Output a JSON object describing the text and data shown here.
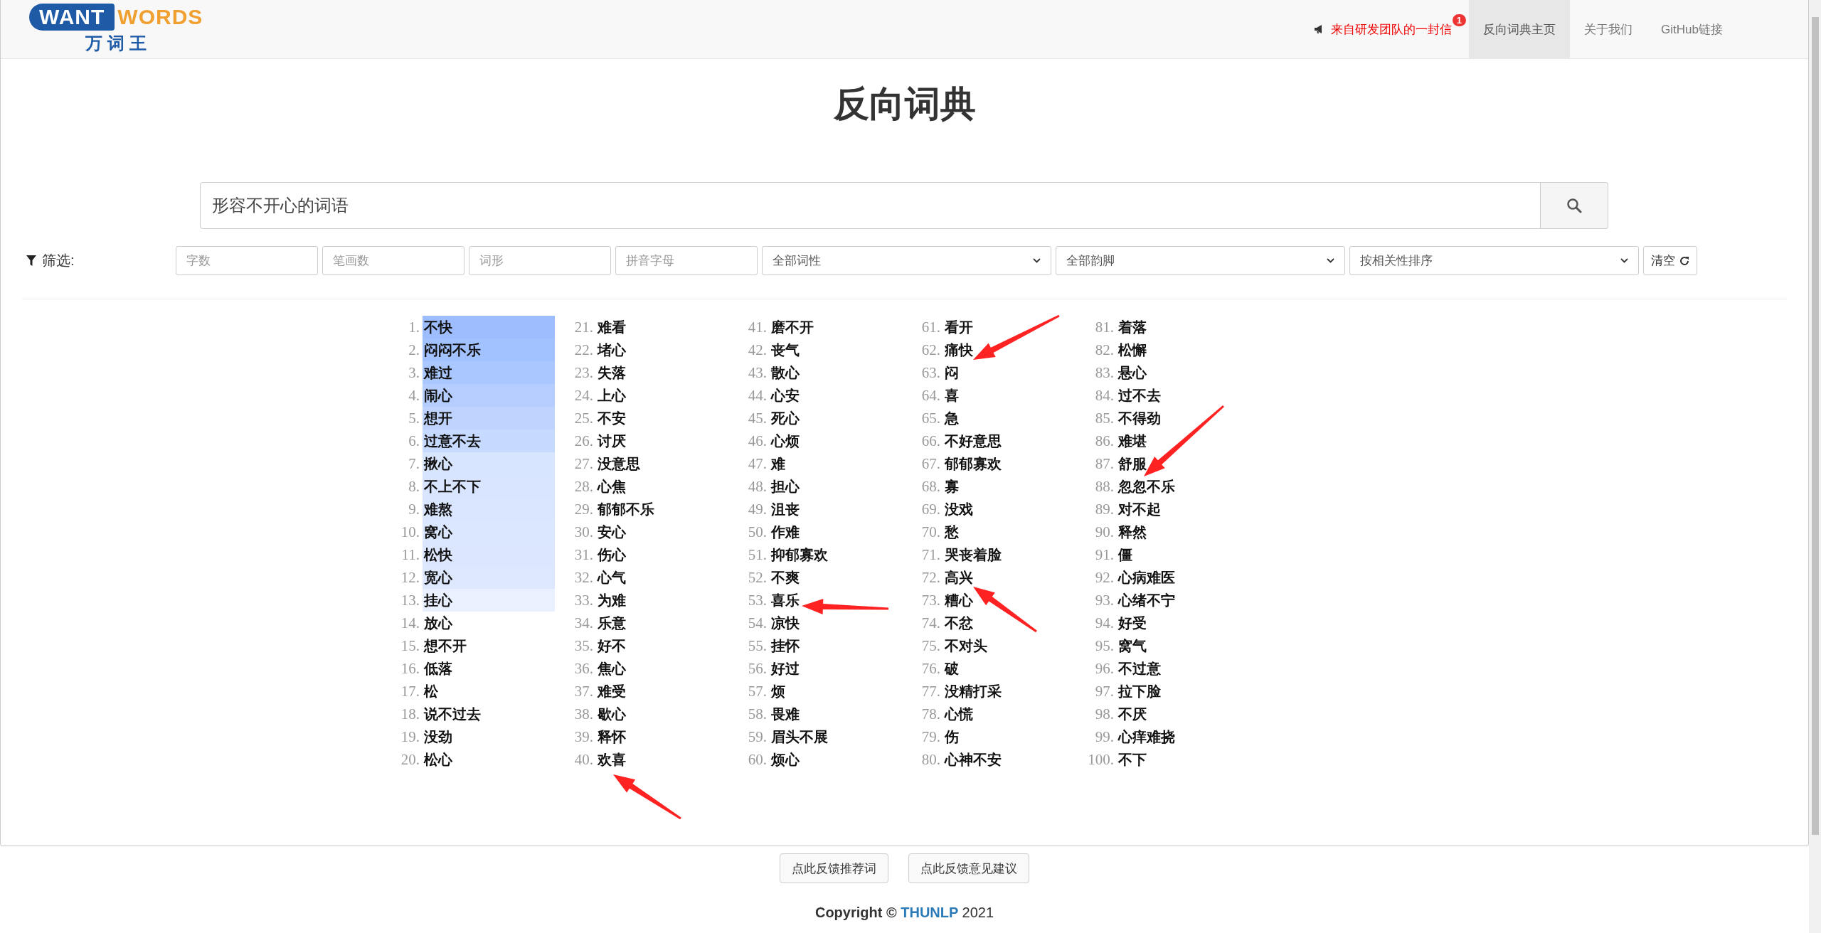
{
  "header": {
    "logo": {
      "word_left": "WANT",
      "word_right": "WORDS",
      "subtitle": "万 词 王"
    },
    "notice": {
      "text": "来自研发团队的一封信",
      "badge": "1"
    },
    "nav": [
      {
        "label": "反向词典主页",
        "selected": true
      },
      {
        "label": "关于我们",
        "selected": false
      },
      {
        "label": "GitHub链接",
        "selected": false
      }
    ]
  },
  "title": "反向词典",
  "search": {
    "value": "形容不开心的词语"
  },
  "filter": {
    "label": "筛选:",
    "fields": [
      {
        "kind": "input",
        "placeholder": "字数"
      },
      {
        "kind": "input",
        "placeholder": "笔画数"
      },
      {
        "kind": "input",
        "placeholder": "词形"
      },
      {
        "kind": "input",
        "placeholder": "拼音字母"
      },
      {
        "kind": "select",
        "value": "全部词性"
      },
      {
        "kind": "select",
        "value": "全部韵脚"
      },
      {
        "kind": "select",
        "value": "按相关性排序"
      }
    ],
    "clear_button": "清空"
  },
  "results": [
    {
      "index": "1.",
      "word": "不快",
      "color": "#9dbdff"
    },
    {
      "index": "2.",
      "word": "闷闷不乐",
      "color": "#a2c1ff"
    },
    {
      "index": "3.",
      "word": "难过",
      "color": "#aac7ff"
    },
    {
      "index": "4.",
      "word": "闹心",
      "color": "#b5ceff"
    },
    {
      "index": "5.",
      "word": "想开",
      "color": "#bed4ff"
    },
    {
      "index": "6.",
      "word": "过意不去",
      "color": "#c6daff"
    },
    {
      "index": "7.",
      "word": "揪心",
      "color": "#d8e5ff"
    },
    {
      "index": "8.",
      "word": "不上不下",
      "color": "#d9e5ff"
    },
    {
      "index": "9.",
      "word": "难熬",
      "color": "#dae6ff"
    },
    {
      "index": "10.",
      "word": "窝心",
      "color": "#dbe7ff"
    },
    {
      "index": "11.",
      "word": "松快",
      "color": "#dce7ff"
    },
    {
      "index": "12.",
      "word": "宽心",
      "color": "#dde8ff"
    },
    {
      "index": "13.",
      "word": "挂心",
      "color": "#e9f0ff"
    },
    {
      "index": "14.",
      "word": "放心"
    },
    {
      "index": "15.",
      "word": "想不开"
    },
    {
      "index": "16.",
      "word": "低落"
    },
    {
      "index": "17.",
      "word": "松"
    },
    {
      "index": "18.",
      "word": "说不过去"
    },
    {
      "index": "19.",
      "word": "没劲"
    },
    {
      "index": "20.",
      "word": "松心"
    },
    {
      "index": "21.",
      "word": "难看"
    },
    {
      "index": "22.",
      "word": "堵心"
    },
    {
      "index": "23.",
      "word": "失落"
    },
    {
      "index": "24.",
      "word": "上心"
    },
    {
      "index": "25.",
      "word": "不安"
    },
    {
      "index": "26.",
      "word": "讨厌"
    },
    {
      "index": "27.",
      "word": "没意思"
    },
    {
      "index": "28.",
      "word": "心焦"
    },
    {
      "index": "29.",
      "word": "郁郁不乐"
    },
    {
      "index": "30.",
      "word": "安心"
    },
    {
      "index": "31.",
      "word": "伤心"
    },
    {
      "index": "32.",
      "word": "心气"
    },
    {
      "index": "33.",
      "word": "为难"
    },
    {
      "index": "34.",
      "word": "乐意"
    },
    {
      "index": "35.",
      "word": "好不"
    },
    {
      "index": "36.",
      "word": "焦心"
    },
    {
      "index": "37.",
      "word": "难受"
    },
    {
      "index": "38.",
      "word": "歇心"
    },
    {
      "index": "39.",
      "word": "释怀"
    },
    {
      "index": "40.",
      "word": "欢喜"
    },
    {
      "index": "41.",
      "word": "磨不开"
    },
    {
      "index": "42.",
      "word": "丧气"
    },
    {
      "index": "43.",
      "word": "散心"
    },
    {
      "index": "44.",
      "word": "心安"
    },
    {
      "index": "45.",
      "word": "死心"
    },
    {
      "index": "46.",
      "word": "心烦"
    },
    {
      "index": "47.",
      "word": "难"
    },
    {
      "index": "48.",
      "word": "担心"
    },
    {
      "index": "49.",
      "word": "沮丧"
    },
    {
      "index": "50.",
      "word": "作难"
    },
    {
      "index": "51.",
      "word": "抑郁寡欢"
    },
    {
      "index": "52.",
      "word": "不爽"
    },
    {
      "index": "53.",
      "word": "喜乐"
    },
    {
      "index": "54.",
      "word": "凉快"
    },
    {
      "index": "55.",
      "word": "挂怀"
    },
    {
      "index": "56.",
      "word": "好过"
    },
    {
      "index": "57.",
      "word": "烦"
    },
    {
      "index": "58.",
      "word": "畏难"
    },
    {
      "index": "59.",
      "word": "眉头不展"
    },
    {
      "index": "60.",
      "word": "烦心"
    },
    {
      "index": "61.",
      "word": "看开"
    },
    {
      "index": "62.",
      "word": "痛快"
    },
    {
      "index": "63.",
      "word": "闷"
    },
    {
      "index": "64.",
      "word": "喜"
    },
    {
      "index": "65.",
      "word": "急"
    },
    {
      "index": "66.",
      "word": "不好意思"
    },
    {
      "index": "67.",
      "word": "郁郁寡欢"
    },
    {
      "index": "68.",
      "word": "寡"
    },
    {
      "index": "69.",
      "word": "没戏"
    },
    {
      "index": "70.",
      "word": "愁"
    },
    {
      "index": "71.",
      "word": "哭丧着脸"
    },
    {
      "index": "72.",
      "word": "高兴"
    },
    {
      "index": "73.",
      "word": "糟心"
    },
    {
      "index": "74.",
      "word": "不忿"
    },
    {
      "index": "75.",
      "word": "不对头"
    },
    {
      "index": "76.",
      "word": "破"
    },
    {
      "index": "77.",
      "word": "没精打采"
    },
    {
      "index": "78.",
      "word": "心慌"
    },
    {
      "index": "79.",
      "word": "伤"
    },
    {
      "index": "80.",
      "word": "心神不安"
    },
    {
      "index": "81.",
      "word": "着落"
    },
    {
      "index": "82.",
      "word": "松懈"
    },
    {
      "index": "83.",
      "word": "悬心"
    },
    {
      "index": "84.",
      "word": "过不去"
    },
    {
      "index": "85.",
      "word": "不得劲"
    },
    {
      "index": "86.",
      "word": "难堪"
    },
    {
      "index": "87.",
      "word": "舒服"
    },
    {
      "index": "88.",
      "word": "忽忽不乐"
    },
    {
      "index": "89.",
      "word": "对不起"
    },
    {
      "index": "90.",
      "word": "释然"
    },
    {
      "index": "91.",
      "word": "僵"
    },
    {
      "index": "92.",
      "word": "心病难医"
    },
    {
      "index": "93.",
      "word": "心绪不宁"
    },
    {
      "index": "94.",
      "word": "好受"
    },
    {
      "index": "95.",
      "word": "窝气"
    },
    {
      "index": "96.",
      "word": "不过意"
    },
    {
      "index": "97.",
      "word": "拉下脸"
    },
    {
      "index": "98.",
      "word": "不厌"
    },
    {
      "index": "99.",
      "word": "心痒难挠"
    },
    {
      "index": "100.",
      "word": "不下"
    }
  ],
  "feedback_buttons": [
    "点此反馈推荐词",
    "点此反馈意见建议"
  ],
  "copyright": {
    "prefix": "Copyright ©",
    "link": "THUNLP",
    "year": "2021"
  }
}
